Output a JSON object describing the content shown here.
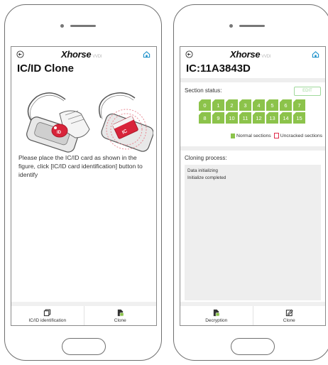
{
  "left_screen": {
    "logo": "Xhorse",
    "logo_suffix": "VVDI",
    "title": "IC/ID Clone",
    "card_label_fob": "ID",
    "card_label_card": "IC",
    "instruction": "Please place the IC/ID card as shown in the figure, click [IC/ID card identification] button to identify",
    "bottom_bar": [
      {
        "label": "IC/ID identification",
        "icon": "copy-icon"
      },
      {
        "label": "Clone",
        "icon": "sim-card-icon"
      }
    ]
  },
  "right_screen": {
    "logo": "Xhorse",
    "logo_suffix": "VVDI",
    "title": "IC:11A3843D",
    "section_status_label": "Section status:",
    "edit_label": "EDIT",
    "sections_row1": [
      "0",
      "1",
      "2",
      "3",
      "4",
      "5",
      "6",
      "7"
    ],
    "sections_row2": [
      "8",
      "9",
      "10",
      "11",
      "12",
      "13",
      "14",
      "15"
    ],
    "legend_normal": "Normal sections",
    "legend_uncracked": "Uncracked sections",
    "cloning_label": "Cloning process:",
    "log": [
      "Data initializing",
      "Initialize completed"
    ],
    "bottom_bar": [
      {
        "label": "Decryption",
        "icon": "sim-card-icon"
      },
      {
        "label": "Clone",
        "icon": "edit-icon"
      }
    ]
  },
  "colors": {
    "section_green": "#8cc34b",
    "uncracked_red": "#e02a4a",
    "card_red": "#d8243a"
  }
}
